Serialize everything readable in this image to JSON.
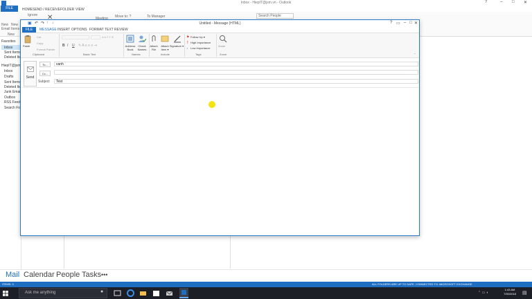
{
  "outlook": {
    "title": "Inbox - HiepIT@jsm.vn - Outlook",
    "file_tab": "FILE",
    "tabs": [
      "HOME",
      "SEND / RECEIVE",
      "FOLDER",
      "VIEW"
    ],
    "ribbon": {
      "ignore": "Ignore",
      "meeting": "Meeting",
      "move_to": "Move to: ?",
      "to_manager": "To Manager",
      "search_people": "Search People",
      "new_email": "New Email",
      "new_items": "New Items",
      "new_group": "New"
    },
    "folders": {
      "favorites": "Favorites",
      "inbox": "Inbox",
      "sent": "Sent Items",
      "deleted": "Deleted Items",
      "account": "HiepIT@jsm",
      "account_items": [
        "Inbox",
        "Drafts",
        "Sent Items",
        "Deleted Items",
        "Junk Email",
        "Outbox",
        "RSS Feeds",
        "Search Folders"
      ]
    },
    "nav": [
      "Mail",
      "Calendar",
      "People",
      "Tasks",
      "•••"
    ],
    "status": {
      "items": "ITEMS: 0",
      "folders_uptodate": "ALL FOLDERS ARE UP TO DATE.",
      "connected": "CONNECTED TO: MICROSOFT EXCHANGE"
    }
  },
  "message": {
    "title": "Untitled - Message (HTML)",
    "file_tab": "FILE",
    "tabs": [
      "MESSAGE",
      "INSERT",
      "OPTIONS",
      "FORMAT TEXT",
      "REVIEW"
    ],
    "clipboard": {
      "paste": "Paste",
      "cut": "Cut",
      "copy": "Copy",
      "format_painter": "Format Painter",
      "label": "Clipboard"
    },
    "basic_text": {
      "bold": "B",
      "italic": "I",
      "underline": "U",
      "label": "Basic Text"
    },
    "names": {
      "address_book": "Address Book",
      "check_names": "Check Names",
      "label": "Names"
    },
    "include": {
      "attach_file": "Attach File",
      "attach_item": "Attach Item ▾",
      "signature": "Signature ▾",
      "label": "Include"
    },
    "tags": {
      "follow_up": "Follow Up ▾",
      "high": "High Importance",
      "low": "Low Importance",
      "label": "Tags"
    },
    "zoom": {
      "zoom": "Zoom",
      "label": "Zoom"
    },
    "send": "Send",
    "to_button": "To...",
    "cc_button": "Cc...",
    "subject_label": "Subject",
    "to_value": "vanh",
    "cc_value": "",
    "subject_value": "Test"
  },
  "taskbar": {
    "search_placeholder": "Ask me anything",
    "time": "1:43 AM",
    "date": "7/30/2018"
  },
  "colors": {
    "accent": "#1e6fc2",
    "taskbar": "#1c1f26",
    "cursor_highlight": "#f5e211"
  }
}
